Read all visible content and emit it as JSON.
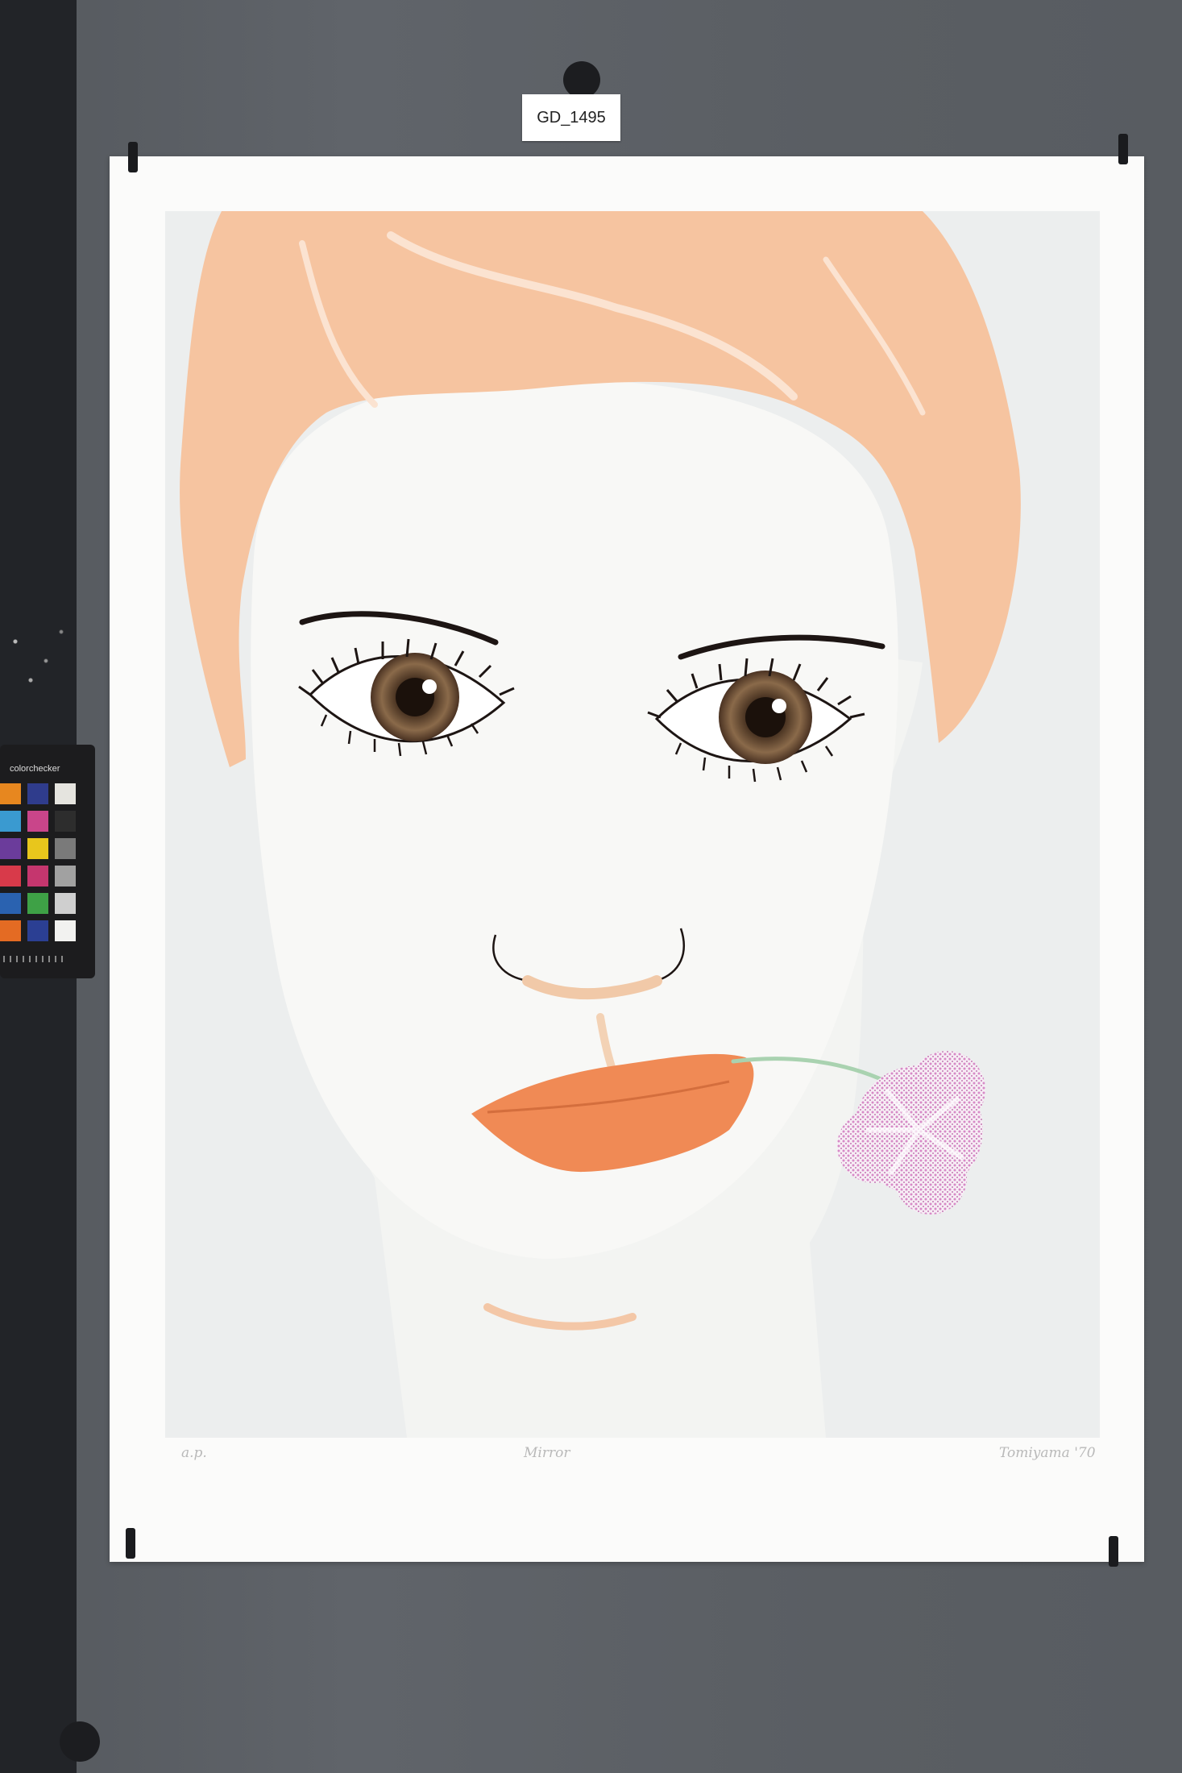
{
  "label": {
    "text": "GD_1495"
  },
  "colorchecker": {
    "brand": "colorchecker",
    "patches": [
      "#e7871f",
      "#2f3c8c",
      "#e5e4df",
      "#3a9ad0",
      "#c9458a",
      "#2d2d2d",
      "#6b3c9b",
      "#e8c61c",
      "#7a7a7a",
      "#d83a4a",
      "#c5366e",
      "#a1a1a1",
      "#2a62b0",
      "#3ea146",
      "#cfcfcf",
      "#e46b23",
      "#2b3f93",
      "#f2f2f0"
    ]
  },
  "artwork": {
    "subject": "portrait of a face with a pink carnation held in the mouth",
    "colors": {
      "hair": "#f6c4a0",
      "skin": "#f6f6f4",
      "background": "#eceeee",
      "lips": "#f08a55",
      "iris": "#6b4d34",
      "lashes": "#1d1513",
      "carnation": "#d78ac7",
      "stem": "#a9d2b0"
    }
  },
  "pencil_annotations": {
    "edition": "a.p.",
    "title": "Mirror",
    "signature": "Tomiyama '70"
  }
}
